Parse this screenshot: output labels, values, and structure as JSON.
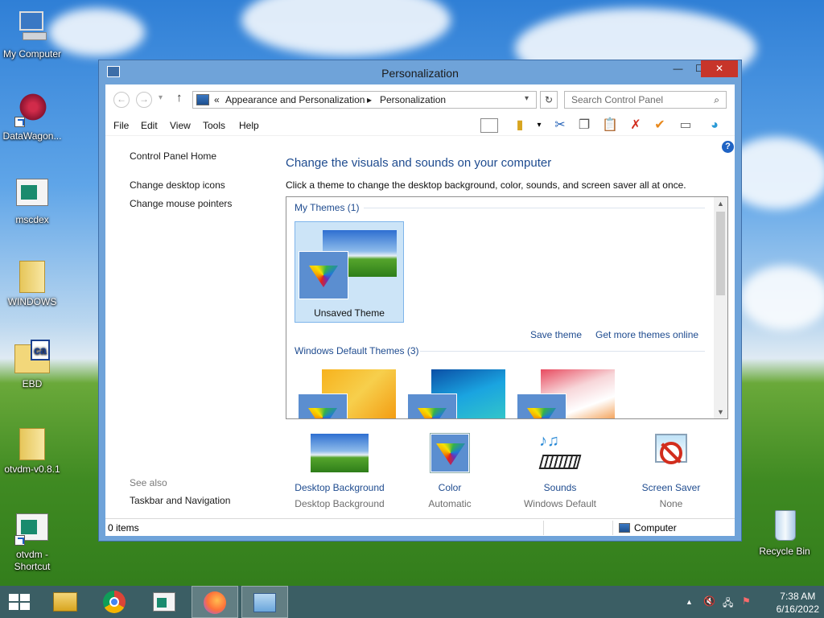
{
  "desktop": {
    "icons": [
      {
        "label": "My Computer"
      },
      {
        "label": "DataWagon..."
      },
      {
        "label": "mscdex"
      },
      {
        "label": "WINDOWS"
      },
      {
        "label": "EBD"
      },
      {
        "label": "otvdm-v0.8.1"
      },
      {
        "label": "otvdm -\nShortcut"
      },
      {
        "label": "Recycle Bin"
      }
    ],
    "ebd_icon_text": "ca"
  },
  "window": {
    "title": "Personalization",
    "controls": {
      "minimize": "—",
      "maximize": "☐",
      "close": "✕"
    }
  },
  "address": {
    "crumbs": [
      "«",
      "Appearance and Personalization",
      "▸",
      "Personalization"
    ],
    "search_placeholder": "Search Control Panel"
  },
  "menu": [
    "File",
    "Edit",
    "View",
    "Tools",
    "Help"
  ],
  "left_pane": {
    "links": [
      "Control Panel Home",
      "Change desktop icons",
      "Change mouse pointers"
    ],
    "see_also": "See also",
    "see_also_links": [
      "Taskbar and Navigation"
    ]
  },
  "main": {
    "heading": "Change the visuals and sounds on your computer",
    "description": "Click a theme to change the desktop background, color, sounds, and screen saver all at once.",
    "my_themes_title": "My Themes (1)",
    "unsaved_theme": "Unsaved Theme",
    "save_theme": "Save theme",
    "get_more": "Get more themes online",
    "default_themes_title": "Windows Default Themes (3)"
  },
  "settings": [
    {
      "name": "Desktop Background",
      "value": "Desktop Background"
    },
    {
      "name": "Color",
      "value": "Automatic"
    },
    {
      "name": "Sounds",
      "value": "Windows Default"
    },
    {
      "name": "Screen Saver",
      "value": "None"
    }
  ],
  "statusbar": {
    "items": "0 items",
    "location": "Computer"
  },
  "taskbar": {
    "time": "7:38 AM",
    "date": "6/16/2022"
  },
  "colors": {
    "accent": "#1e4b8f",
    "close": "#c7352a",
    "selection": "#cce4f7"
  }
}
